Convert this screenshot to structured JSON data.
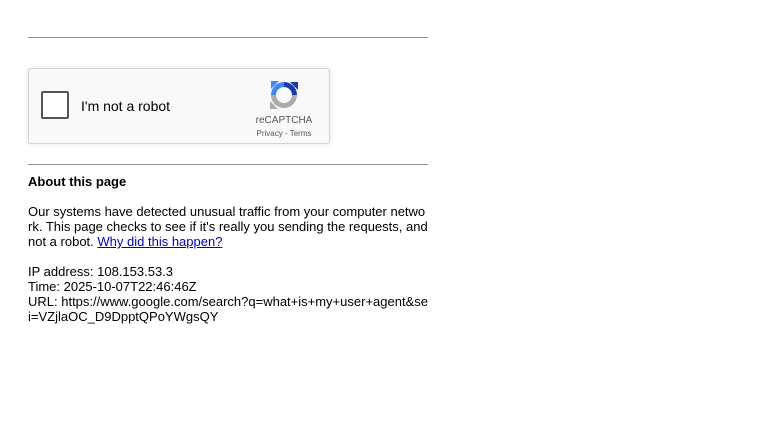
{
  "recaptcha": {
    "checkbox_label": "I'm not a robot",
    "brand": "reCAPTCHA",
    "privacy_link": "Privacy",
    "separator": " - ",
    "terms_link": "Terms"
  },
  "about": {
    "heading": "About this page",
    "message": "Our systems have detected unusual traffic from your computer network. This page checks to see if it's really you sending the requests, and not a robot.",
    "why_link": "Why did this happen?"
  },
  "details": {
    "ip": "IP address: 108.153.53.3",
    "time": "Time: 2025-10-07T22:46:46Z",
    "url": "URL: https://www.google.com/search?q=what+is+my+user+agent&sei=VZjlaOC_D9DpptQPoYWgsQY"
  },
  "colors": {
    "link": "#0000cc",
    "rule": "#8f8f8f",
    "recaptcha_bg": "#f9f9f9"
  },
  "icons": {
    "recaptcha_logo": "recaptcha-logo-icon"
  }
}
